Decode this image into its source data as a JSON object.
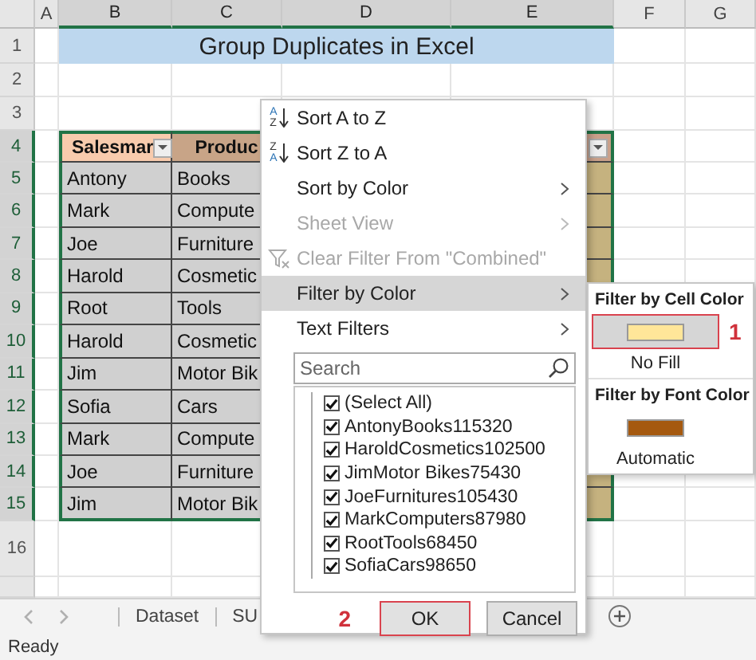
{
  "sheet": {
    "column_headers": [
      "A",
      "B",
      "C",
      "D",
      "E",
      "F",
      "G"
    ],
    "row_headers": [
      "1",
      "2",
      "3",
      "4",
      "5",
      "6",
      "7",
      "8",
      "9",
      "10",
      "11",
      "12",
      "13",
      "14",
      "15",
      "16"
    ],
    "title": "Group Duplicates in Excel",
    "table_headers": [
      "Salesmar",
      "Produc"
    ],
    "rows": [
      [
        "Antony",
        "Books"
      ],
      [
        "Mark",
        "Compute"
      ],
      [
        "Joe",
        "Furniture"
      ],
      [
        "Harold",
        "Cosmetic"
      ],
      [
        "Root",
        "Tools"
      ],
      [
        "Harold",
        "Cosmetic"
      ],
      [
        "Jim",
        "Motor Bik"
      ],
      [
        "Sofia",
        "Cars"
      ],
      [
        "Mark",
        "Compute"
      ],
      [
        "Joe",
        "Furniture"
      ],
      [
        "Jim",
        "Motor Bik"
      ]
    ]
  },
  "filter_menu": {
    "items": [
      {
        "kind": "sort_asc",
        "icon_letters": [
          "A",
          "Z"
        ],
        "label": "Sort A to Z",
        "disabled": false,
        "selected": false,
        "submenu": false
      },
      {
        "kind": "sort_desc",
        "icon_letters": [
          "Z",
          "A"
        ],
        "label": "Sort Z to A",
        "disabled": false,
        "selected": false,
        "submenu": false
      },
      {
        "kind": "plain",
        "label": "Sort by Color",
        "disabled": false,
        "selected": false,
        "submenu": true
      },
      {
        "kind": "plain",
        "label": "Sheet View",
        "disabled": true,
        "selected": false,
        "submenu": true
      },
      {
        "kind": "clear",
        "label": "Clear Filter From \"Combined\"",
        "disabled": true,
        "selected": false,
        "submenu": false
      },
      {
        "kind": "plain",
        "label": "Filter by Color",
        "disabled": false,
        "selected": true,
        "submenu": true
      },
      {
        "kind": "plain",
        "label": "Text Filters",
        "disabled": false,
        "selected": false,
        "submenu": true
      }
    ],
    "search": {
      "placeholder": "Search"
    },
    "values": [
      {
        "label": "(Select All)",
        "checked": true
      },
      {
        "label": "AntonyBooks115320",
        "checked": true
      },
      {
        "label": "HaroldCosmetics102500",
        "checked": true
      },
      {
        "label": "JimMotor Bikes75430",
        "checked": true
      },
      {
        "label": "JoeFurnitures105430",
        "checked": true
      },
      {
        "label": "MarkComputers87980",
        "checked": true
      },
      {
        "label": "RootTools68450",
        "checked": true
      },
      {
        "label": "SofiaCars98650",
        "checked": true
      }
    ],
    "marker": "2",
    "buttons": [
      {
        "label": "OK",
        "outlined": true
      },
      {
        "label": "Cancel",
        "outlined": false
      }
    ]
  },
  "color_submenu": {
    "sections": [
      {
        "heading": "Filter by Cell Color",
        "swatches": [
          {
            "color": "#ffe699",
            "selected": true,
            "marker": "1"
          }
        ],
        "option": "No Fill"
      },
      {
        "heading": "Filter by Font Color",
        "swatches": [
          {
            "color": "#a5590f",
            "selected": false
          }
        ],
        "option": "Automatic"
      }
    ]
  },
  "sheet_tabs": [
    "Dataset",
    "SU"
  ],
  "status_bar": {
    "text": "Ready"
  }
}
